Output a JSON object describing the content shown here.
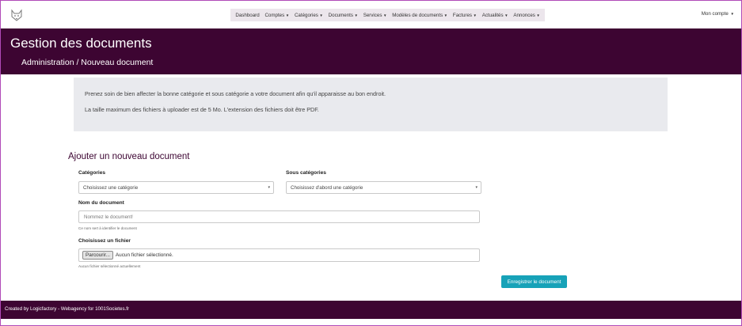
{
  "nav": {
    "logo_icon": "cat-head-icon",
    "items": [
      {
        "label": "Dashboard",
        "caret": false
      },
      {
        "label": "Comptes",
        "caret": true
      },
      {
        "label": "Catégories",
        "caret": true
      },
      {
        "label": "Documents",
        "caret": true
      },
      {
        "label": "Services",
        "caret": true
      },
      {
        "label": "Modèles de documents",
        "caret": true
      },
      {
        "label": "Factures",
        "caret": true
      },
      {
        "label": "Actualités",
        "caret": true
      },
      {
        "label": "Annonces",
        "caret": true
      }
    ],
    "account": "Mon compte"
  },
  "header": {
    "title": "Gestion des documents",
    "breadcrumb": "Administration / Nouveau document"
  },
  "info": {
    "line1": "Prenez soin de bien affecter la bonne catégorie et sous catégorie a votre document afin qu'il apparaisse au bon endroit.",
    "line2": "La taille maximum des fichiers à uploader est de 5 Mo. L'extension des fichiers doit être PDF."
  },
  "form": {
    "title": "Ajouter un nouveau document",
    "category_label": "Catégories",
    "category_value": "Choisissez une catégorie",
    "subcategory_label": "Sous catégories",
    "subcategory_value": "Choisissez d'abord une catégorie",
    "name_label": "Nom du document",
    "name_placeholder": "Nommez le document!",
    "name_help": "Ce nom sert à identifier le document",
    "file_label": "Choisissez un fichier",
    "browse_label": "Parcourir...",
    "file_status": "Aucun fichier sélectionné.",
    "file_help": "Aucun fichier sélectionné actuellement",
    "submit_label": "Enregistrer le document"
  },
  "footer": {
    "text": "Created by Logicfactory - Webagency for 1001Societes.fr"
  },
  "colors": {
    "brand": "#3d0532",
    "accent": "#17a2b8",
    "info_bg": "#e9eaee"
  }
}
